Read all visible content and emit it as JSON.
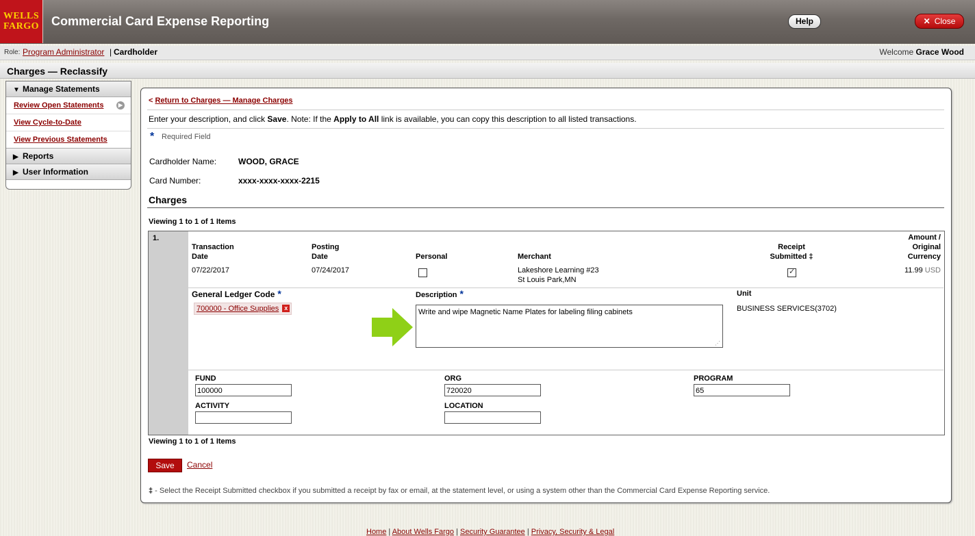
{
  "header": {
    "logo_line1": "WELLS",
    "logo_line2": "FARGO",
    "app_title": "Commercial Card Expense Reporting",
    "help_label": "Help",
    "close_label": "Close"
  },
  "role_bar": {
    "role_label": "Role:",
    "program_admin": "Program Administrator",
    "separator": "|",
    "cardholder": "Cardholder",
    "welcome_prefix": "Welcome",
    "user_name": "Grace Wood"
  },
  "page": {
    "title": "Charges — Reclassify"
  },
  "sidebar": {
    "manage_statements": "Manage Statements",
    "links": [
      "Review Open Statements",
      "View Cycle-to-Date",
      "View Previous Statements"
    ],
    "reports": "Reports",
    "user_information": "User Information"
  },
  "main": {
    "return_link": "Return to Charges — Manage Charges",
    "instr_1": "Enter your description, and click ",
    "instr_save": "Save",
    "instr_2": ". Note: If the ",
    "instr_apply": "Apply to All",
    "instr_3": " link is available, you can copy this description to all listed transactions.",
    "required_field": "Required Field",
    "cardholder_name_label": "Cardholder Name:",
    "cardholder_name": "WOOD, GRACE",
    "card_number_label": "Card Number:",
    "card_number": "xxxx-xxxx-xxxx-2215",
    "charges_heading": "Charges",
    "viewing": "Viewing 1 to 1 of 1 Items"
  },
  "table": {
    "row_number": "1.",
    "headers": {
      "transaction_date_1": "Transaction",
      "transaction_date_2": "Date",
      "posting_date_1": "Posting",
      "posting_date_2": "Date",
      "personal": "Personal",
      "merchant": "Merchant",
      "receipt_1": "Receipt",
      "receipt_2": "Submitted ‡",
      "amount_1": "Amount /",
      "amount_2": "Original",
      "amount_3": "Currency"
    },
    "row": {
      "transaction_date": "07/22/2017",
      "posting_date": "07/24/2017",
      "merchant_1": "Lakeshore Learning #23",
      "merchant_2": "St Louis Park,MN",
      "amount": "11.99",
      "currency": "USD"
    },
    "gl_label": "General Ledger Code",
    "gl_value": "700000 - Office Supplies",
    "description_label": "Description",
    "description_value": "Write and wipe Magnetic Name Plates for labeling filing cabinets",
    "unit_label": "Unit",
    "unit_value": "BUSINESS SERVICES(3702)",
    "fund_label": "FUND",
    "fund_value": "100000",
    "org_label": "ORG",
    "org_value": "720020",
    "program_label": "PROGRAM",
    "program_value": "65",
    "activity_label": "ACTIVITY",
    "activity_value": "",
    "location_label": "LOCATION",
    "location_value": ""
  },
  "actions": {
    "save": "Save",
    "cancel": "Cancel"
  },
  "footnote": {
    "mark": "‡",
    "text": " - Select the Receipt Submitted checkbox if you submitted a receipt by fax or email, at the statement level, or using a system other than the Commercial Card Expense Reporting service."
  },
  "footer": {
    "links": [
      "Home",
      "About Wells Fargo",
      "Security Guarantee",
      "Privacy, Security & Legal"
    ],
    "separator": " | "
  },
  "colors": {
    "brand_red": "#c0141b",
    "link": "#8b0000",
    "accent_arrow": "#8fd017",
    "star_blue": "#003399"
  }
}
